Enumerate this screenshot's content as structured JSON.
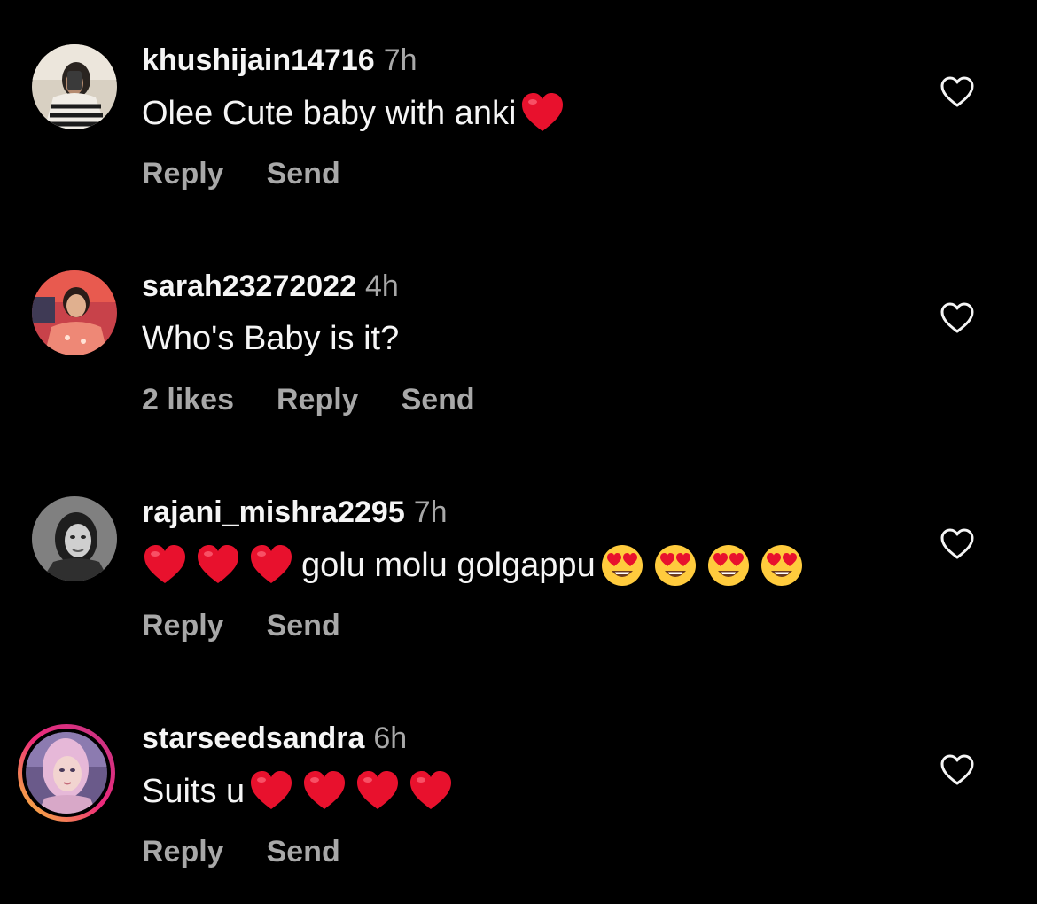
{
  "comments": [
    {
      "username": "khushijain14716",
      "time": "7h",
      "text_before": "Olee Cute baby with anki",
      "emojis_before": [],
      "emojis_after": [
        "red-heart"
      ],
      "likes": "",
      "reply_label": "Reply",
      "send_label": "Send",
      "avatar": "avatar-photo-1"
    },
    {
      "username": "sarah23272022",
      "time": "4h",
      "text_before": "Who's Baby is it?",
      "emojis_before": [],
      "emojis_after": [],
      "likes": "2 likes",
      "reply_label": "Reply",
      "send_label": "Send",
      "avatar": "avatar-photo-2"
    },
    {
      "username": "rajani_mishra2295",
      "time": "7h",
      "text_before": "golu molu golgappu",
      "emojis_before": [
        "red-heart",
        "red-heart",
        "red-heart"
      ],
      "emojis_after": [
        "heart-eyes",
        "heart-eyes",
        "heart-eyes",
        "heart-eyes"
      ],
      "likes": "",
      "reply_label": "Reply",
      "send_label": "Send",
      "avatar": "avatar-photo-3"
    },
    {
      "username": "starseedsandra",
      "time": "6h",
      "text_before": "Suits u",
      "emojis_before": [],
      "emojis_after": [
        "red-heart",
        "red-heart",
        "red-heart",
        "red-heart"
      ],
      "likes": "",
      "reply_label": "Reply",
      "send_label": "Send",
      "avatar": "avatar-photo-4-story-ring"
    }
  ],
  "colors": {
    "background": "#000000",
    "primary_text": "#f5f5f5",
    "secondary_text": "#a8a8a8",
    "heart_red": "#e8112d",
    "story_ring_start": "#f9ce34",
    "story_ring_end": "#c13584"
  },
  "icons": {
    "like": "heart-outline-icon"
  }
}
